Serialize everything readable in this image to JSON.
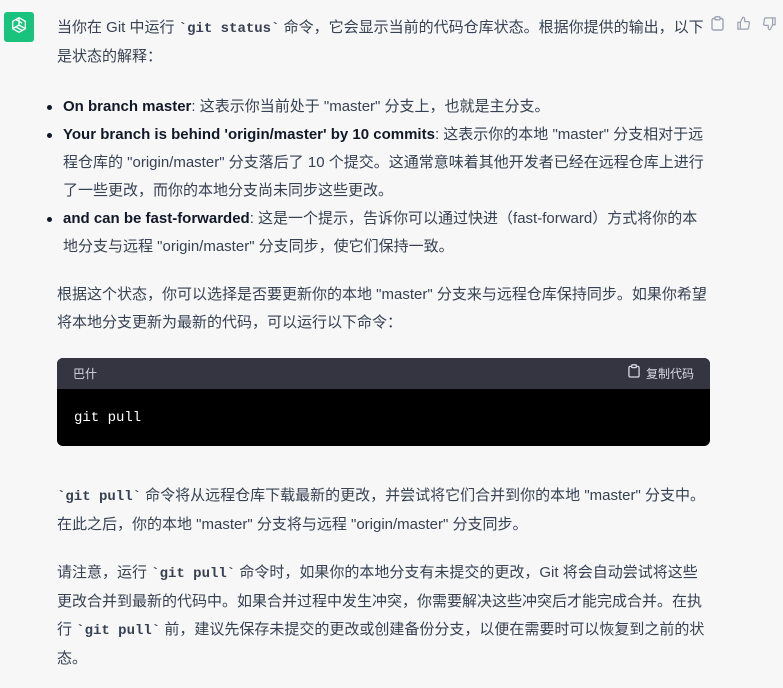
{
  "avatar": {
    "icon": "openai-logo-icon",
    "color": "#19c37d"
  },
  "actions": [
    {
      "icon": "clipboard-icon"
    },
    {
      "icon": "thumbs-up-icon"
    },
    {
      "icon": "thumbs-down-icon"
    }
  ],
  "intro": {
    "pre": "当你在 Git 中运行 ",
    "cmd": "`git status`",
    "post": " 命令，它会显示当前的代码仓库状态。根据你提供的输出，以下是状态的解释："
  },
  "bullets": [
    {
      "bold": "On branch master",
      "text": ": 这表示你当前处于 \"master\" 分支上，也就是主分支。"
    },
    {
      "bold": "Your branch is behind 'origin/master' by 10 commits",
      "text": ": 这表示你的本地 \"master\" 分支相对于远程仓库的 \"origin/master\" 分支落后了 10 个提交。这通常意味着其他开发者已经在远程仓库上进行了一些更改，而你的本地分支尚未同步这些更改。"
    },
    {
      "bold": "and can be fast-forwarded",
      "text": ": 这是一个提示，告诉你可以通过快进（fast-forward）方式将你的本地分支与远程 \"origin/master\" 分支同步，使它们保持一致。"
    }
  ],
  "para2": "根据这个状态，你可以选择是否要更新你的本地 \"master\" 分支来与远程仓库保持同步。如果你希望将本地分支更新为最新的代码，可以运行以下命令：",
  "code": {
    "language": "巴什",
    "copy_label": "复制代码",
    "copy_icon": "clipboard-icon",
    "content": "git pull"
  },
  "para3": {
    "cmd": "`git pull`",
    "post": " 命令将从远程仓库下载最新的更改，并尝试将它们合并到你的本地 \"master\" 分支中。在此之后，你的本地 \"master\" 分支将与远程 \"origin/master\" 分支同步。"
  },
  "para4": {
    "pre": "请注意，运行 ",
    "cmd1": "`git pull`",
    "mid": " 命令时，如果你的本地分支有未提交的更改，Git 将会自动尝试将这些更改合并到最新的代码中。如果合并过程中发生冲突，你需要解决这些冲突后才能完成合并。在执行 ",
    "cmd2": "`git pull`",
    "post": " 前，建议先保存未提交的更改或创建备份分支，以便在需要时可以恢复到之前的状态。"
  }
}
